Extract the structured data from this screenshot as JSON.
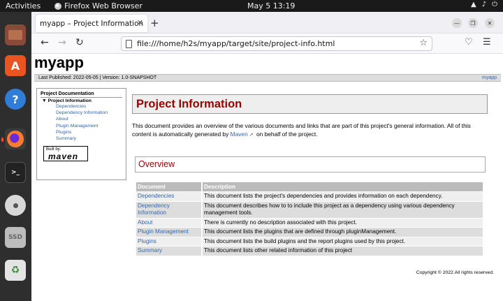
{
  "topbar": {
    "activities": "Activities",
    "app_name": "Firefox Web Browser",
    "clock": "May 5  13:19"
  },
  "dock": {
    "items": [
      "files-icon",
      "software-icon",
      "help-icon",
      "firefox-icon",
      "terminal-icon",
      "disc-icon",
      "ssd-icon",
      "trash-icon"
    ],
    "ssd_label": "SSD",
    "terminal_label": ">_",
    "help_label": "?",
    "accent": "#e95420"
  },
  "browser": {
    "tab_title": "myapp – Project Information",
    "url": "file:///home/h2s/myapp/target/site/project-info.html"
  },
  "page": {
    "site_title": "myapp",
    "published": "Last Published: 2022-05-05  | Version: 1.0-SNAPSHOT",
    "published_right": "myapp",
    "nav": {
      "heading": "Project Documentation",
      "current": "Project Information",
      "items": [
        "Dependencies",
        "Dependency Information",
        "About",
        "Plugin Management",
        "Plugins",
        "Summary"
      ]
    },
    "badge": {
      "built_by": "Built by:",
      "maven": "maven"
    },
    "heading": "Project Information",
    "intro_before": "This document provides an overview of the various documents and links that are part of this project's general information. All of this content is automatically generated by ",
    "intro_link": "Maven",
    "intro_after": " on behalf of the project.",
    "overview_heading": "Overview",
    "table": {
      "headers": [
        "Document",
        "Description"
      ],
      "rows": [
        {
          "doc": "Dependencies",
          "desc": "This document lists the project's dependencies and provides information on each dependency."
        },
        {
          "doc": "Dependency Information",
          "desc": "This document describes how to to include this project as a dependency using various dependency management tools."
        },
        {
          "doc": "About",
          "desc": "There is currently no description associated with this project."
        },
        {
          "doc": "Plugin Management",
          "desc": "This document lists the plugins that are defined through pluginManagement."
        },
        {
          "doc": "Plugins",
          "desc": "This document lists the build plugins and the report plugins used by this project."
        },
        {
          "doc": "Summary",
          "desc": "This document lists other related information of this project"
        }
      ]
    },
    "footer": "Copyright © 2022.All rights reserved."
  }
}
